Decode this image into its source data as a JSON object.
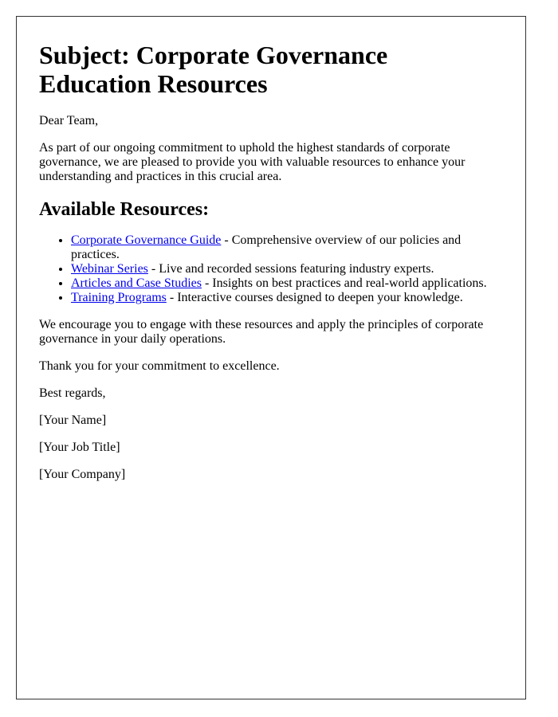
{
  "letter": {
    "subject": "Subject: Corporate Governance Education Resources",
    "greeting": "Dear Team,",
    "intro": "As part of our ongoing commitment to uphold the highest standards of corporate governance, we are pleased to provide you with valuable resources to enhance your understanding and practices in this crucial area.",
    "resources_heading": "Available Resources:",
    "resources": [
      {
        "link": "Corporate Governance Guide",
        "description": " - Comprehensive overview of our policies and practices."
      },
      {
        "link": "Webinar Series",
        "description": " - Live and recorded sessions featuring industry experts."
      },
      {
        "link": "Articles and Case Studies",
        "description": " - Insights on best practices and real-world applications."
      },
      {
        "link": "Training Programs",
        "description": " - Interactive courses designed to deepen your knowledge."
      }
    ],
    "encourage": "We encourage you to engage with these resources and apply the principles of corporate governance in your daily operations.",
    "thanks": "Thank you for your commitment to excellence.",
    "closing": "Best regards,",
    "name": "[Your Name]",
    "job_title": "[Your Job Title]",
    "company": "[Your Company]"
  },
  "colors": {
    "link": "#0000ee",
    "border": "#333333"
  }
}
